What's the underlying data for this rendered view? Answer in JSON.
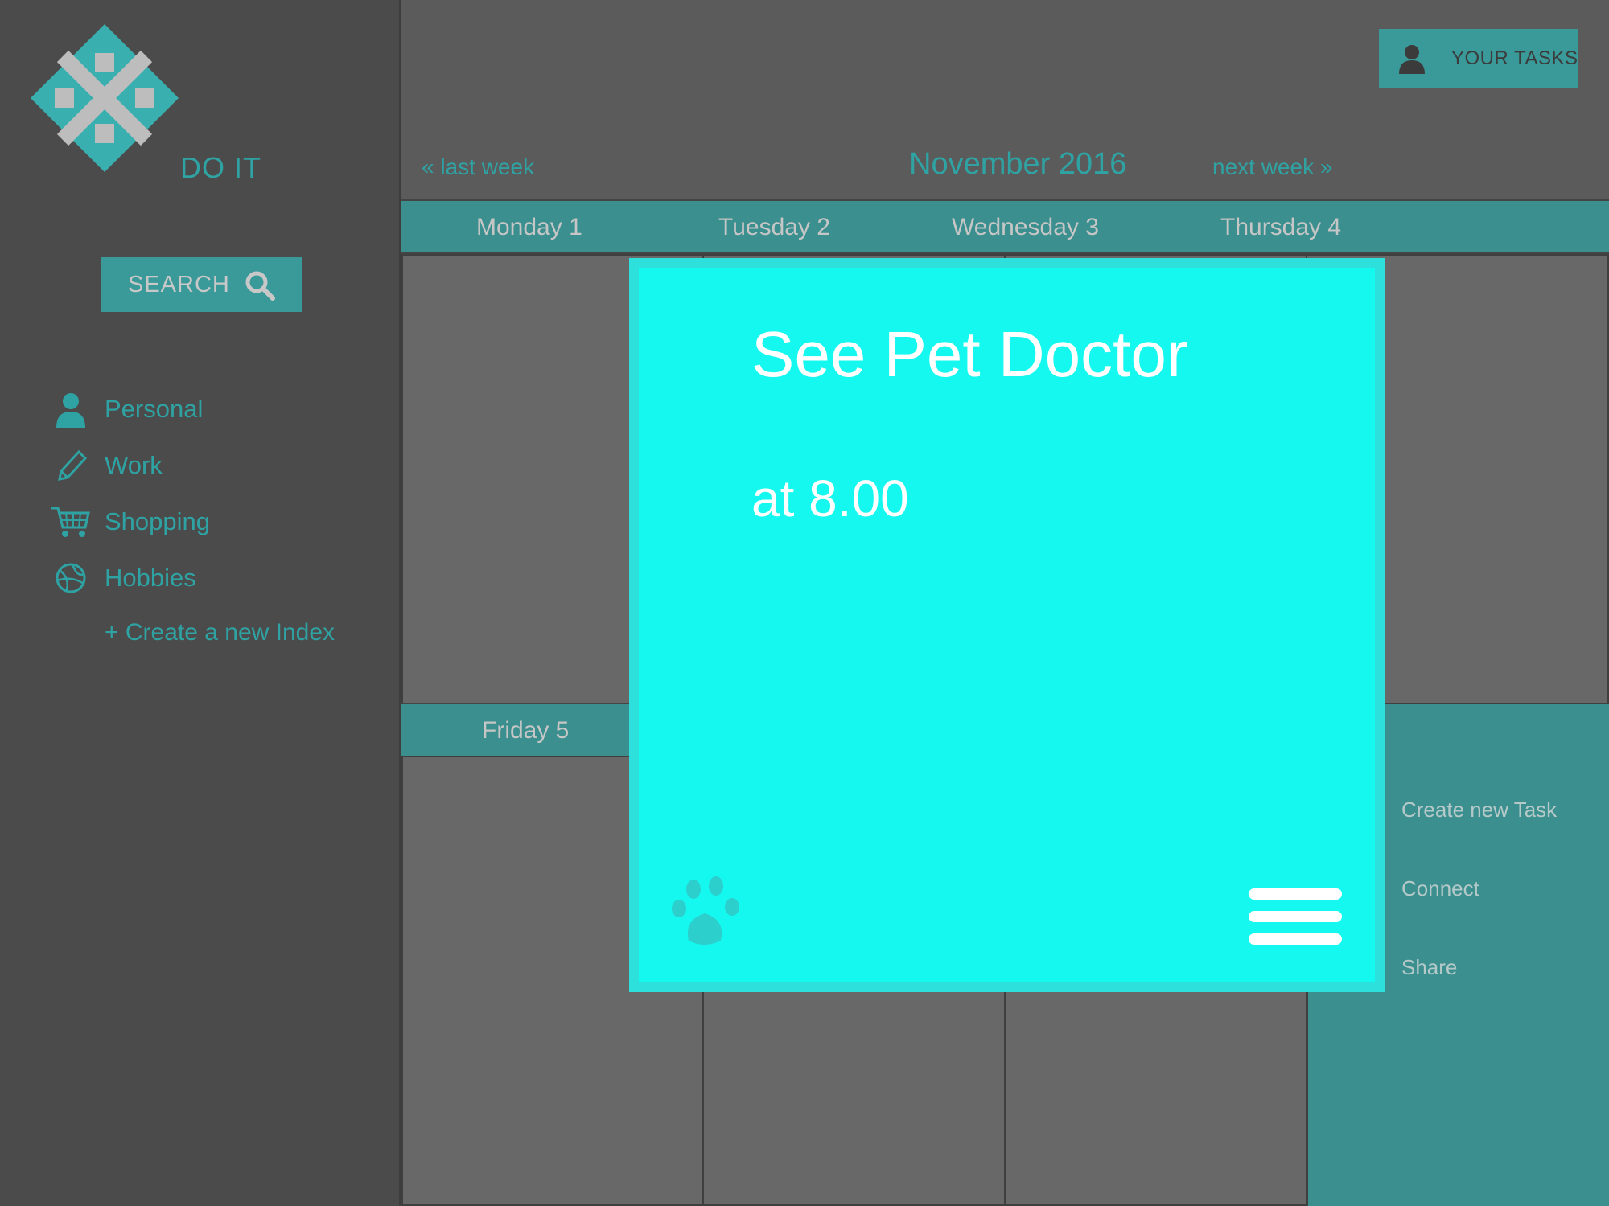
{
  "app": {
    "name": "DO IT",
    "logo_icon": "diamond-logo-icon"
  },
  "search": {
    "label": "SEARCH",
    "icon": "search-icon"
  },
  "sidebar": {
    "items": [
      {
        "label": "Personal",
        "icon": "person-icon"
      },
      {
        "label": "Work",
        "icon": "pencil-icon"
      },
      {
        "label": "Shopping",
        "icon": "cart-icon"
      },
      {
        "label": "Hobbies",
        "icon": "ball-icon"
      }
    ],
    "create_index": "+ Create a new Index"
  },
  "header": {
    "your_tasks": "YOUR TASKS",
    "your_tasks_icon": "person-icon"
  },
  "calendar": {
    "prev": "« last week",
    "next": "next week »",
    "month": "November 2016",
    "days": [
      "Monday 1",
      "Tuesday 2",
      "Wednesday 3",
      "Thursday 4",
      "Friday 5"
    ]
  },
  "side_menu": {
    "items": [
      "Create new Task",
      "Connect",
      "Share"
    ]
  },
  "modal": {
    "title": "See Pet Doctor",
    "time": "at 8.00",
    "category_icon": "paw-icon",
    "menu_icon": "hamburger-menu-icon"
  },
  "colors": {
    "accent": "#2fa3a3",
    "bar": "#3b8f8f",
    "modal": "#15f8ef",
    "sidebar_bg": "#4b4b4b",
    "main_bg": "#5b5b5b",
    "cell_bg": "#686868"
  }
}
